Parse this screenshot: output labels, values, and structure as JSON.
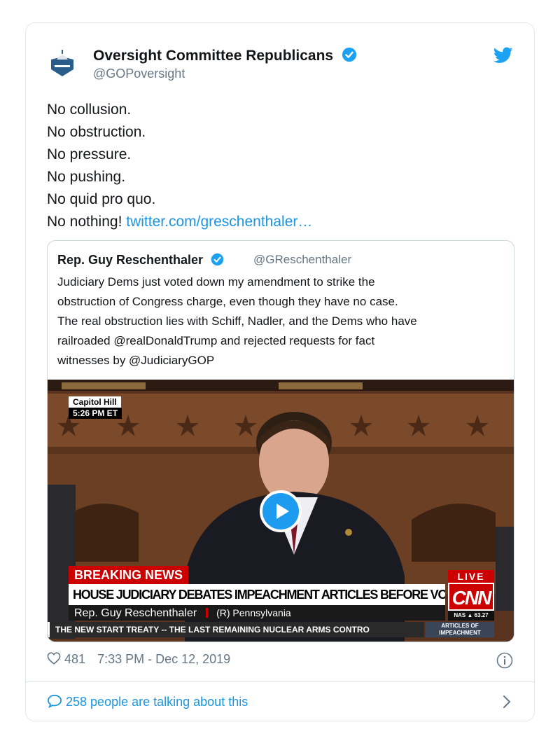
{
  "tweet": {
    "author_name": "Oversight Committee Republicans",
    "handle": "@GOPoversight",
    "lines": [
      "No collusion.",
      "No obstruction.",
      "No pressure.",
      "No pushing.",
      "No quid pro quo.",
      "No nothing!"
    ],
    "link": "twitter.com/greschenthaler…",
    "likes": "481",
    "timestamp": "7:33 PM - Dec 12, 2019",
    "talking": "258 people are talking about this"
  },
  "quote": {
    "author_name": "Rep. Guy Reschenthaler",
    "handle": "@GReschenthaler",
    "lines": [
      "Judiciary Dems just voted down my amendment to strike the",
      "obstruction of Congress charge, even though they have no case.",
      "The real obstruction lies with Schiff, Nadler, and the Dems who have",
      "railroaded @realDonaldTrump and rejected requests for fact",
      "witnesses by @JudiciaryGOP"
    ]
  },
  "video": {
    "location": "Capitol Hill",
    "time": "5:26 PM ET",
    "breaking": "BREAKING NEWS",
    "headline": "HOUSE JUDICIARY DEBATES IMPEACHMENT ARTICLES BEFORE VOTE",
    "speaker": "Rep. Guy Reschenthaler",
    "party": "(R) Pennsylvania",
    "ticker": "THE NEW START TREATY -- THE LAST REMAINING NUCLEAR ARMS CONTRO",
    "live": "LIVE",
    "network": "CNN",
    "market": "NAS ▲ 63.27",
    "section_line1": "ARTICLES OF",
    "section_line2": "IMPEACHMENT"
  },
  "colors": {
    "link": "#1b95e0",
    "muted": "#657786",
    "border": "#e1e8ed",
    "cnn_red": "#cc0000"
  }
}
